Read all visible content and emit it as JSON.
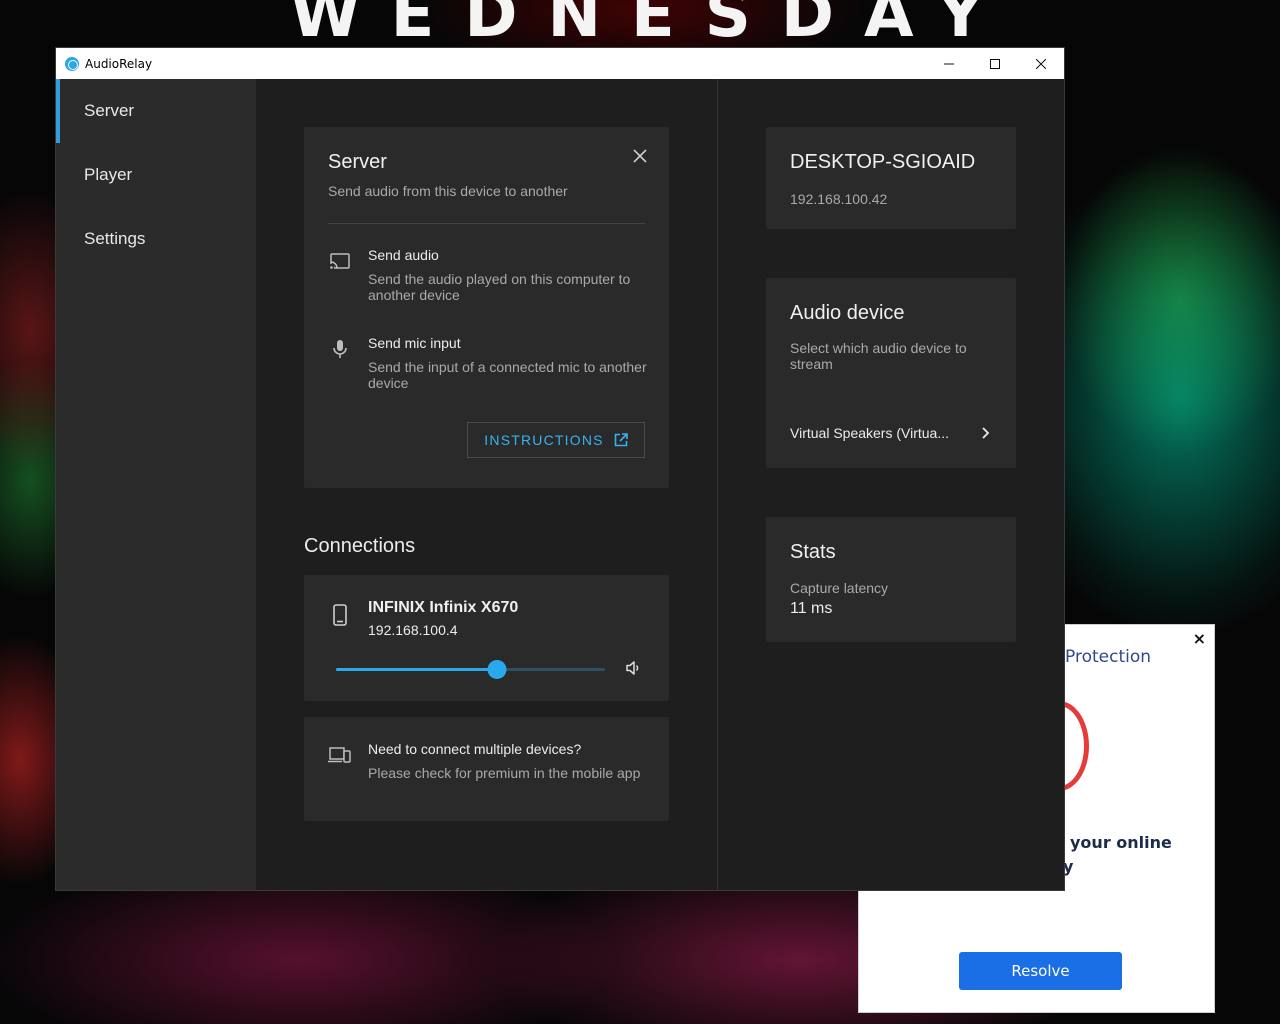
{
  "wallpaper": {
    "title": "WEDNESDAY"
  },
  "popup": {
    "title": "Protection",
    "text_line1": "your online",
    "text_line2": "y",
    "resolve_label": "Resolve",
    "close_label": "×"
  },
  "window": {
    "title": "AudioRelay"
  },
  "sidebar": {
    "items": [
      {
        "label": "Server",
        "active": true
      },
      {
        "label": "Player",
        "active": false
      },
      {
        "label": "Settings",
        "active": false
      }
    ]
  },
  "server": {
    "title": "Server",
    "subtitle": "Send audio from this device to another",
    "options": [
      {
        "title": "Send audio",
        "description": "Send the audio played on this computer to another device",
        "icon": "cast-icon"
      },
      {
        "title": "Send mic input",
        "description": "Send the input of a connected mic to another device",
        "icon": "mic-icon"
      }
    ],
    "instructions_label": "INSTRUCTIONS"
  },
  "connections": {
    "title": "Connections",
    "device": {
      "name": "INFINIX Infinix X670",
      "ip": "192.168.100.4",
      "volume": 0.6
    },
    "premium": {
      "title": "Need to connect multiple devices?",
      "description": "Please check for premium in the mobile app"
    }
  },
  "pc": {
    "hostname": "DESKTOP-SGIOAID",
    "ip": "192.168.100.42"
  },
  "audio_device": {
    "title": "Audio device",
    "description": "Select which audio device to stream",
    "selected": "Virtual Speakers (Virtua..."
  },
  "stats": {
    "title": "Stats",
    "latency_label": "Capture latency",
    "latency_value": "11 ms"
  },
  "colors": {
    "accent": "#2aa8ee",
    "background": "#1e1e1e",
    "card": "#2a2a2a",
    "sidebar": "#2b2b2b"
  }
}
